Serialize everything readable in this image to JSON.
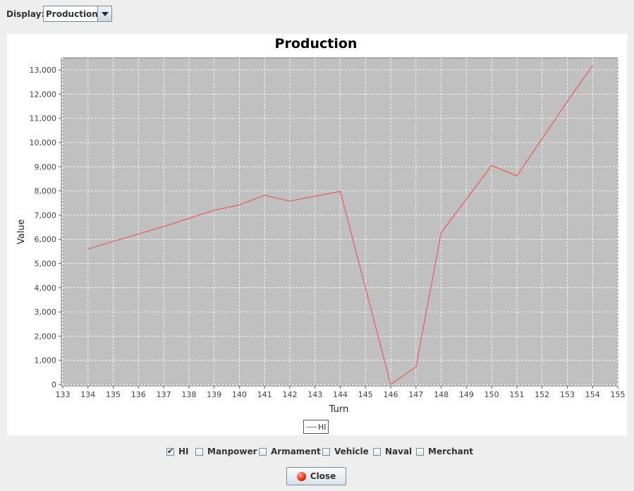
{
  "toolbar": {
    "display_label": "Display:",
    "display_value": "Production"
  },
  "chart_data": {
    "type": "line",
    "title": "Production",
    "xlabel": "Turn",
    "ylabel": "Value",
    "xlim": [
      133,
      155
    ],
    "ylim": [
      0,
      13500
    ],
    "xticks": [
      133,
      134,
      135,
      136,
      137,
      138,
      139,
      140,
      141,
      142,
      143,
      144,
      145,
      146,
      147,
      148,
      149,
      150,
      151,
      152,
      153,
      154,
      155
    ],
    "yticks": [
      0,
      1000,
      2000,
      3000,
      4000,
      5000,
      6000,
      7000,
      8000,
      9000,
      10000,
      11000,
      12000,
      13000
    ],
    "ytick_labels": [
      "0",
      "1,000",
      "2,000",
      "3,000",
      "4,000",
      "5,000",
      "6,000",
      "7,000",
      "8,000",
      "9,000",
      "10,000",
      "11,000",
      "12,000",
      "13,000"
    ],
    "grid": true,
    "legend_position": "bottom-center",
    "series": [
      {
        "name": "HI",
        "color": "#e86060",
        "x": [
          134,
          137,
          139,
          140,
          141,
          142,
          144,
          146,
          147,
          148,
          150,
          151,
          153,
          154
        ],
        "y": [
          5600,
          6530,
          7200,
          7420,
          7820,
          7580,
          7980,
          0,
          720,
          6280,
          9050,
          8620,
          11700,
          13180
        ]
      }
    ]
  },
  "filters": [
    {
      "label": "HI",
      "checked": true
    },
    {
      "label": "Manpower",
      "checked": false
    },
    {
      "label": "Armament",
      "checked": false
    },
    {
      "label": "Vehicle",
      "checked": false
    },
    {
      "label": "Naval",
      "checked": false
    },
    {
      "label": "Merchant",
      "checked": false
    }
  ],
  "close_button": {
    "label": "Close"
  }
}
